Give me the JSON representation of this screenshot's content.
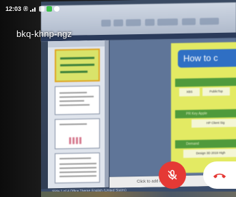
{
  "status_bar": {
    "time": "12:03",
    "network_label": "Ⓡ",
    "icons": [
      "signal-icon",
      "message-icon",
      "app-icon-green",
      "chrome-icon"
    ]
  },
  "meeting": {
    "code": "bkq-khnp-ngz"
  },
  "shared_screen": {
    "slide_title": "How to c",
    "bands": [
      "",
      "PR Key Apple",
      "Demand"
    ],
    "boxes": [
      "XBS",
      "PublicTop",
      "HP Client Sig",
      "Design 3D 2019 High"
    ],
    "notes_placeholder": "Click to add notes",
    "status_text": "Slide 1 of 4    Office Theme    English (United States)"
  },
  "controls": {
    "mic_state": "muted",
    "colors": {
      "mic_bg": "#e53935",
      "end_bg": "#ffffff",
      "end_icon": "#e53935"
    }
  }
}
